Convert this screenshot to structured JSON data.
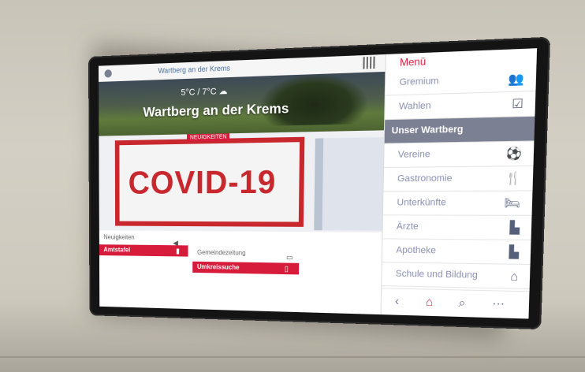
{
  "screen": {
    "topbar": {
      "title": "Wartberg an der Krems"
    },
    "hero": {
      "weather": "5°C / 7°C ☁",
      "town": "Wartberg an der Krems"
    },
    "news": {
      "badge": "NEUIGKEITEN",
      "headline_image_text": "COVID-19"
    },
    "tiles": {
      "caption_left": "Neuigkeiten",
      "amtstafel": "Amtstafel",
      "caption_right": "Gemeindezeitung",
      "umkreissuche": "Umkreissuche"
    },
    "menu": {
      "title": "Menü",
      "items": [
        {
          "label": "Gremium",
          "icon": "group-icon"
        },
        {
          "label": "Wahlen",
          "icon": "ballot-icon"
        },
        {
          "label": "Unser Wartberg",
          "icon": "",
          "active": true
        },
        {
          "label": "Vereine",
          "icon": "soccer-ball-icon"
        },
        {
          "label": "Gastronomie",
          "icon": "cutlery-icon"
        },
        {
          "label": "Unterkünfte",
          "icon": "bed-icon"
        },
        {
          "label": "Ärzte",
          "icon": "factory-icon"
        },
        {
          "label": "Apotheke",
          "icon": "factory-icon"
        },
        {
          "label": "Schule und Bildung",
          "icon": "school-icon"
        }
      ],
      "nav": [
        "back-icon",
        "home-icon",
        "search-icon",
        "more-icon"
      ]
    }
  },
  "colors": {
    "accent": "#d71b3b",
    "active_menu": "#7c8093",
    "menu_text": "#8a8fb0"
  }
}
